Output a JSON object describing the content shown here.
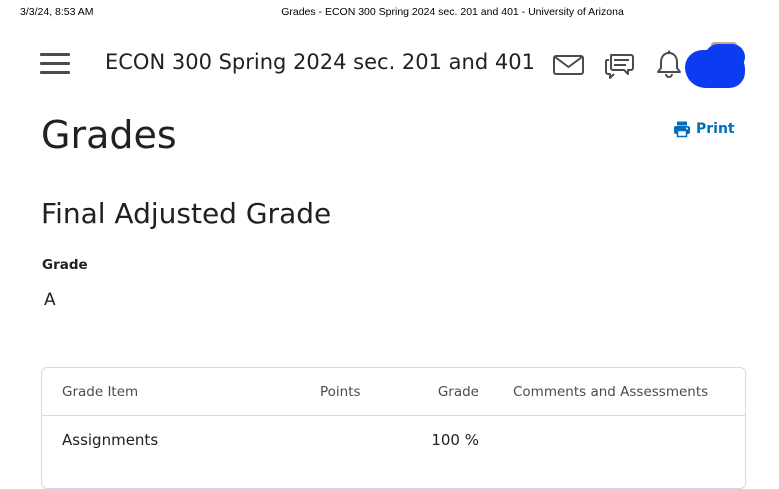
{
  "print_header": {
    "date": "3/3/24, 8:53 AM",
    "doc_title": "Grades - ECON 300 Spring 2024 sec. 201 and 401 - University of Arizona"
  },
  "navbar": {
    "course_title": "ECON 300 Spring 2024 sec. 201 and 401",
    "icons": [
      "menu-icon",
      "mail-icon",
      "chat-icon",
      "bell-icon",
      "avatar"
    ]
  },
  "page": {
    "title": "Grades",
    "print_label": "Print"
  },
  "final_grade": {
    "section_title": "Final Adjusted Grade",
    "label": "Grade",
    "value": "A"
  },
  "table": {
    "headers": {
      "item": "Grade Item",
      "points": "Points",
      "grade": "Grade",
      "comments": "Comments and Assessments"
    },
    "rows": [
      {
        "item": "Assignments",
        "points": "",
        "grade": "100 %",
        "comments": ""
      }
    ]
  },
  "colors": {
    "link": "#006fbf",
    "text": "#202122",
    "border": "#d3d9e3",
    "avatar_redaction": "#0b3cf2"
  }
}
